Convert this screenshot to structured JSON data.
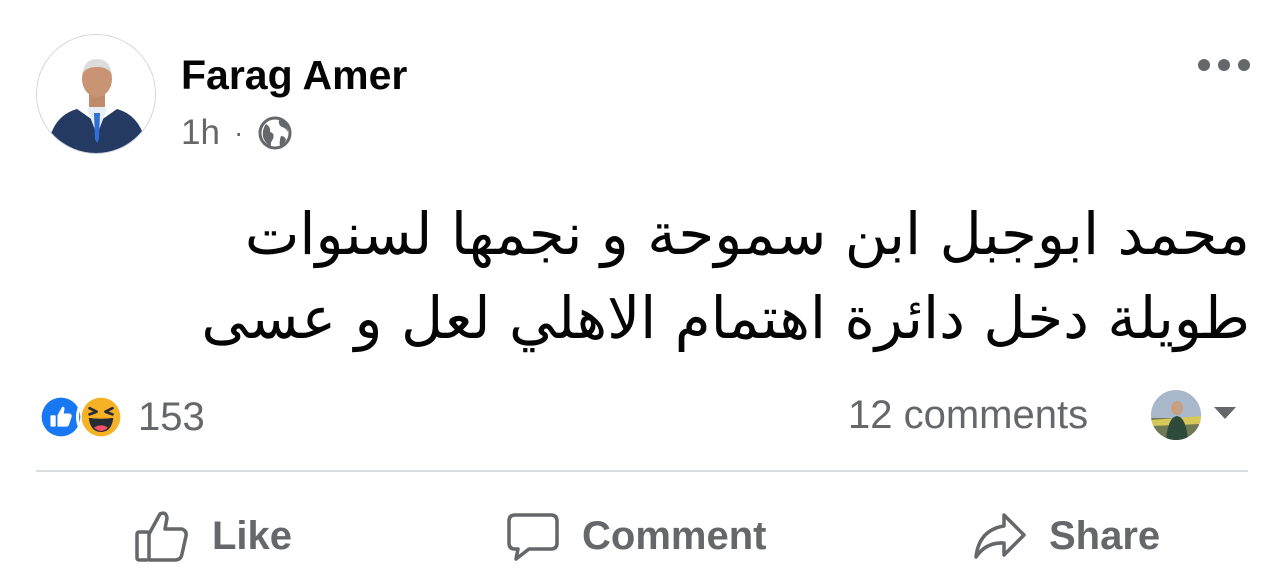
{
  "post": {
    "author_name": "Farag Amer",
    "time": "1h",
    "separator": "·",
    "privacy_icon": "globe-icon",
    "more_icon": "more-options-icon",
    "text": "محمد ابوجبل ابن سموحة و نجمها لسنوات طويلة دخل دائرة اهتمام الاهلي لعل و عسى"
  },
  "engagement": {
    "reactions": [
      "like-reaction-icon",
      "haha-reaction-icon"
    ],
    "reaction_count": "153",
    "comments_label": "12 comments",
    "colors": {
      "like": "#1877f2",
      "haha": "#f7b125",
      "meta_text": "#65676b"
    }
  },
  "actions": [
    {
      "label": "Like",
      "icon": "thumbs-up-icon"
    },
    {
      "label": "Comment",
      "icon": "comment-bubble-icon"
    },
    {
      "label": "Share",
      "icon": "share-arrow-icon"
    }
  ]
}
